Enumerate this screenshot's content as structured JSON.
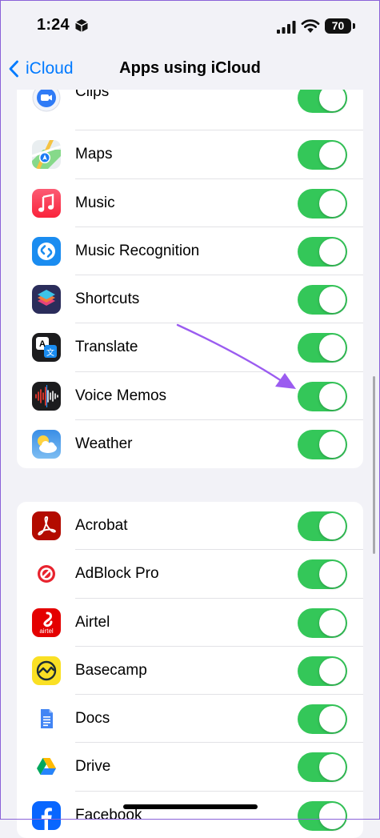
{
  "status_bar": {
    "time": "1:24",
    "battery": "70"
  },
  "nav": {
    "back_label": "iCloud",
    "title": "Apps using iCloud"
  },
  "groups": [
    {
      "items": [
        {
          "label": "Clips",
          "icon": "clips-icon",
          "enabled": true
        },
        {
          "label": "Maps",
          "icon": "maps-icon",
          "enabled": true
        },
        {
          "label": "Music",
          "icon": "music-icon",
          "enabled": true
        },
        {
          "label": "Music Recognition",
          "icon": "shazam-icon",
          "enabled": true
        },
        {
          "label": "Shortcuts",
          "icon": "shortcuts-icon",
          "enabled": true
        },
        {
          "label": "Translate",
          "icon": "translate-icon",
          "enabled": true
        },
        {
          "label": "Voice Memos",
          "icon": "voice-memos-icon",
          "enabled": true
        },
        {
          "label": "Weather",
          "icon": "weather-icon",
          "enabled": true
        }
      ]
    },
    {
      "items": [
        {
          "label": "Acrobat",
          "icon": "acrobat-icon",
          "enabled": true
        },
        {
          "label": "AdBlock Pro",
          "icon": "adblock-icon",
          "enabled": true
        },
        {
          "label": "Airtel",
          "icon": "airtel-icon",
          "enabled": true
        },
        {
          "label": "Basecamp",
          "icon": "basecamp-icon",
          "enabled": true
        },
        {
          "label": "Docs",
          "icon": "docs-icon",
          "enabled": true
        },
        {
          "label": "Drive",
          "icon": "drive-icon",
          "enabled": true
        },
        {
          "label": "Facebook",
          "icon": "facebook-icon",
          "enabled": true
        }
      ]
    }
  ],
  "icon_text": {
    "airtel": "airtel",
    "translate_a": "A",
    "translate_b": "文"
  },
  "colors": {
    "toggle_on": "#34c759",
    "accent": "#007aff",
    "annotation": "#9b5cf0"
  }
}
